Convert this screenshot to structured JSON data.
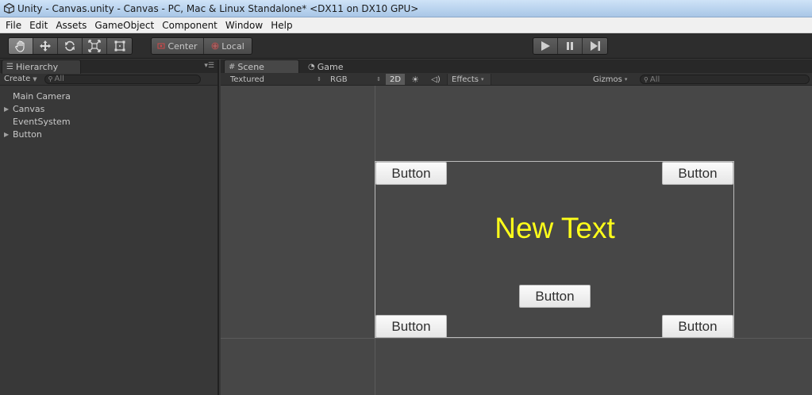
{
  "window": {
    "title": "Unity - Canvas.unity - Canvas - PC, Mac & Linux Standalone* <DX11 on DX10 GPU>"
  },
  "menu": [
    "File",
    "Edit",
    "Assets",
    "GameObject",
    "Component",
    "Window",
    "Help"
  ],
  "toolbar": {
    "tools": [
      "hand-icon",
      "move-icon",
      "rotate-icon",
      "scale-icon",
      "rect-tool-icon"
    ],
    "active_tool": "hand-icon",
    "pivot_label": "Center",
    "space_label": "Local",
    "playback": [
      "play-icon",
      "pause-icon",
      "step-icon"
    ]
  },
  "hierarchy": {
    "tab_label": "Hierarchy",
    "create_label": "Create",
    "search_placeholder": "All",
    "items": [
      {
        "label": "Main Camera",
        "expandable": false
      },
      {
        "label": "Canvas",
        "expandable": true
      },
      {
        "label": "EventSystem",
        "expandable": false
      },
      {
        "label": "Button",
        "expandable": true
      }
    ]
  },
  "scene": {
    "tabs": {
      "scene": "Scene",
      "game": "Game"
    },
    "shading": "Textured",
    "render_mode": "RGB",
    "mode_2d": "2D",
    "effects": "Effects",
    "gizmos": "Gizmos",
    "search_placeholder": "All"
  },
  "canvas": {
    "buttons": [
      "Button",
      "Button",
      "Button",
      "Button",
      "Button"
    ],
    "text": "New Text",
    "text_color": "#ffff1a"
  }
}
